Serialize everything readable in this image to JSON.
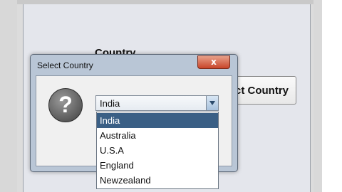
{
  "outer": {
    "title": "Country",
    "button_label": "Select Country"
  },
  "dialog": {
    "title": "Select Country",
    "close_glyph": "x",
    "icon": "question-icon",
    "combo": {
      "selected": "India",
      "options": [
        "India",
        "Australia",
        "U.S.A",
        "England",
        "Newzealand"
      ]
    }
  },
  "colors": {
    "selection": "#3a5f85",
    "close_button": "#c8452a"
  }
}
